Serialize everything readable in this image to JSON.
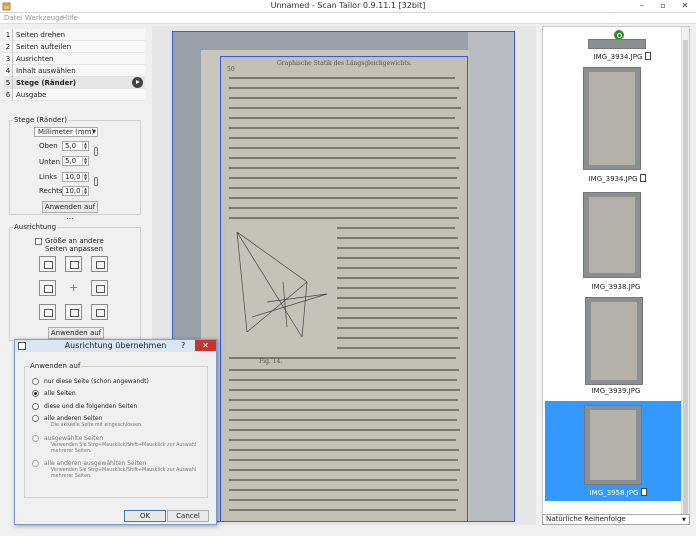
{
  "window": {
    "title": "Unnamed - Scan Tailor 0.9.11.1 [32bit]",
    "minimize": "–",
    "maximize": "▫",
    "close": "✕"
  },
  "menu": [
    "Datei",
    "Werkzeuge",
    "Hilfe"
  ],
  "stages": [
    {
      "num": "1",
      "label": "Seiten drehen"
    },
    {
      "num": "2",
      "label": "Seiten aufteilen"
    },
    {
      "num": "3",
      "label": "Ausrichten"
    },
    {
      "num": "4",
      "label": "Inhalt auswählen"
    },
    {
      "num": "5",
      "label": "Stege (Ränder)"
    },
    {
      "num": "6",
      "label": "Ausgabe"
    }
  ],
  "margins": {
    "title": "Stege (Ränder)",
    "unit": "Millimeter (mm)",
    "top_label": "Oben",
    "top_value": "5,0",
    "bottom_label": "Unten",
    "bottom_value": "5,0",
    "left_label": "Links",
    "left_value": "10,0",
    "right_label": "Rechts",
    "right_value": "10,0",
    "apply": "Anwenden auf ..."
  },
  "alignment": {
    "title": "Ausrichtung",
    "match_size": "Größe an andere Seiten anpassen",
    "apply": "Anwenden auf ..."
  },
  "thumbnails": [
    {
      "label": "IMG_3934.JPG"
    },
    {
      "label": "IMG_3934.JPG"
    },
    {
      "label": "IMG_3938.JPG"
    },
    {
      "label": "IMG_3939.JPG"
    },
    {
      "label": "IMG_3958.JPG"
    }
  ],
  "sort": {
    "value": "Natürliche Reihenfolge"
  },
  "dialog": {
    "title": "Ausrichtung übernehmen",
    "help": "?",
    "close": "✕",
    "group_title": "Anwenden auf",
    "options": [
      {
        "label": "nur diese Seite (schon angewandt)",
        "hint": ""
      },
      {
        "label": "alle Seiten",
        "hint": ""
      },
      {
        "label": "diese und die folgenden Seiten",
        "hint": ""
      },
      {
        "label": "alle anderen Seiten",
        "hint": "Die aktuelle Seite mit eingeschlossen."
      },
      {
        "label": "ausgewählte Seiten",
        "hint": "Verwenden Sie Strg+Mausklick/Shift+Mausklick zur Auswahl mehrerer Seiten."
      },
      {
        "label": "alle anderen ausgewählten Seiten",
        "hint": "Verwenden Sie Strg+Mausklick/Shift+Mausklick zur Auswahl mehrerer Seiten."
      }
    ],
    "ok": "OK",
    "cancel": "Cancel"
  },
  "scan": {
    "header": "Graphische Statik des Längsgleichgewichts.",
    "page_number": "50",
    "fig_label": "Fig. 14."
  }
}
